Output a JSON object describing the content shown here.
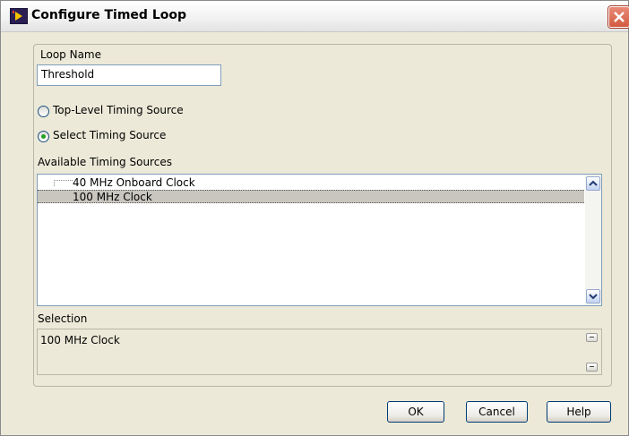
{
  "window": {
    "title": "Configure Timed Loop",
    "close_glyph": "✕"
  },
  "loop_name": {
    "label": "Loop Name",
    "value": "Threshold"
  },
  "timing_mode": {
    "options": [
      {
        "label": "Top-Level Timing Source",
        "selected": false
      },
      {
        "label": "Select Timing Source",
        "selected": true
      }
    ]
  },
  "sources": {
    "label": "Available Timing Sources",
    "items": [
      {
        "label": "40 MHz Onboard Clock",
        "selected": false
      },
      {
        "label": "100 MHz Clock",
        "selected": true
      }
    ]
  },
  "selection": {
    "label": "Selection",
    "value": "100 MHz Clock"
  },
  "buttons": {
    "ok": "OK",
    "cancel": "Cancel",
    "help": "Help"
  },
  "colors": {
    "dialog_bg": "#ece9d8",
    "selected_row": "#c8c6bf",
    "radio_dot": "#21a121",
    "close_button": "#d35a40"
  }
}
